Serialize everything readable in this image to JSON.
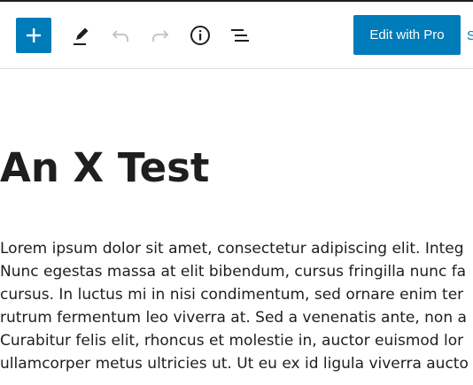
{
  "toolbar": {
    "add_icon": "plus-icon",
    "tools": [
      {
        "name": "pencil-icon"
      },
      {
        "name": "undo-icon"
      },
      {
        "name": "redo-icon"
      },
      {
        "name": "info-icon"
      },
      {
        "name": "list-view-icon"
      }
    ],
    "pro_button_label": "Edit with Pro",
    "clipped_label": "S"
  },
  "colors": {
    "accent": "#007cba",
    "text": "#1e1e1e",
    "disabled_icon": "#c0c0c0"
  },
  "post": {
    "title": "An X Test",
    "lines": [
      "Lorem ipsum dolor sit amet, consectetur adipiscing elit. Integ",
      "Nunc egestas massa at elit bibendum, cursus fringilla nunc fa",
      "cursus. In luctus mi in nisi condimentum, sed ornare enim ter",
      "rutrum fermentum leo viverra at. Sed a venenatis ante, non a",
      "Curabitur felis elit, rhoncus et molestie in, auctor euismod lor",
      "ullamcorper metus ultricies ut. Ut eu ex id ligula viverra aucto"
    ]
  }
}
